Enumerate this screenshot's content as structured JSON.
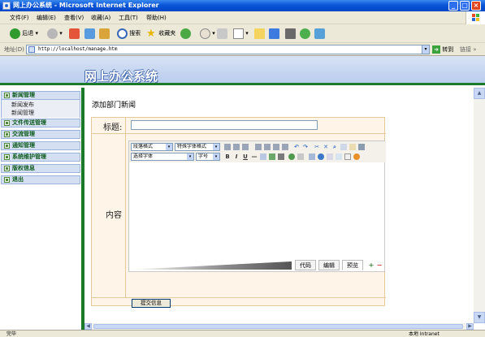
{
  "window": {
    "title": "网上办公系统 - Microsoft Internet Explorer"
  },
  "menu": [
    "文件(F)",
    "编辑(E)",
    "查看(V)",
    "收藏(A)",
    "工具(T)",
    "帮助(H)"
  ],
  "toolbar": {
    "back": "后退",
    "search": "搜索",
    "favorites": "收藏夹"
  },
  "address": {
    "label": "地址(D)",
    "url": "http://localhost/manage.htm",
    "go": "转到",
    "links": "链接"
  },
  "banner": {
    "title": "网上办公系统"
  },
  "sidebar": {
    "sections": [
      {
        "label": "新闻管理",
        "items": [
          "新闻发布",
          "新闻管理"
        ]
      },
      {
        "label": "文件传送管理"
      },
      {
        "label": "交流管理"
      },
      {
        "label": "通知管理"
      },
      {
        "label": "系统维护管理"
      },
      {
        "label": "版权信息"
      },
      {
        "label": "退出"
      }
    ]
  },
  "content": {
    "heading": "添加部门新闻",
    "title_label": "标题:",
    "content_label": "内容",
    "editor": {
      "paragraph_format": "段落格式",
      "special_format": "特殊字体格式",
      "font": "选择字体",
      "size": "字号",
      "tabs": [
        "代码",
        "编辑",
        "预览"
      ],
      "active_tab": "预览"
    },
    "submit": "提交信息"
  },
  "status": {
    "left": "完毕",
    "right": "本地 Intranet"
  }
}
